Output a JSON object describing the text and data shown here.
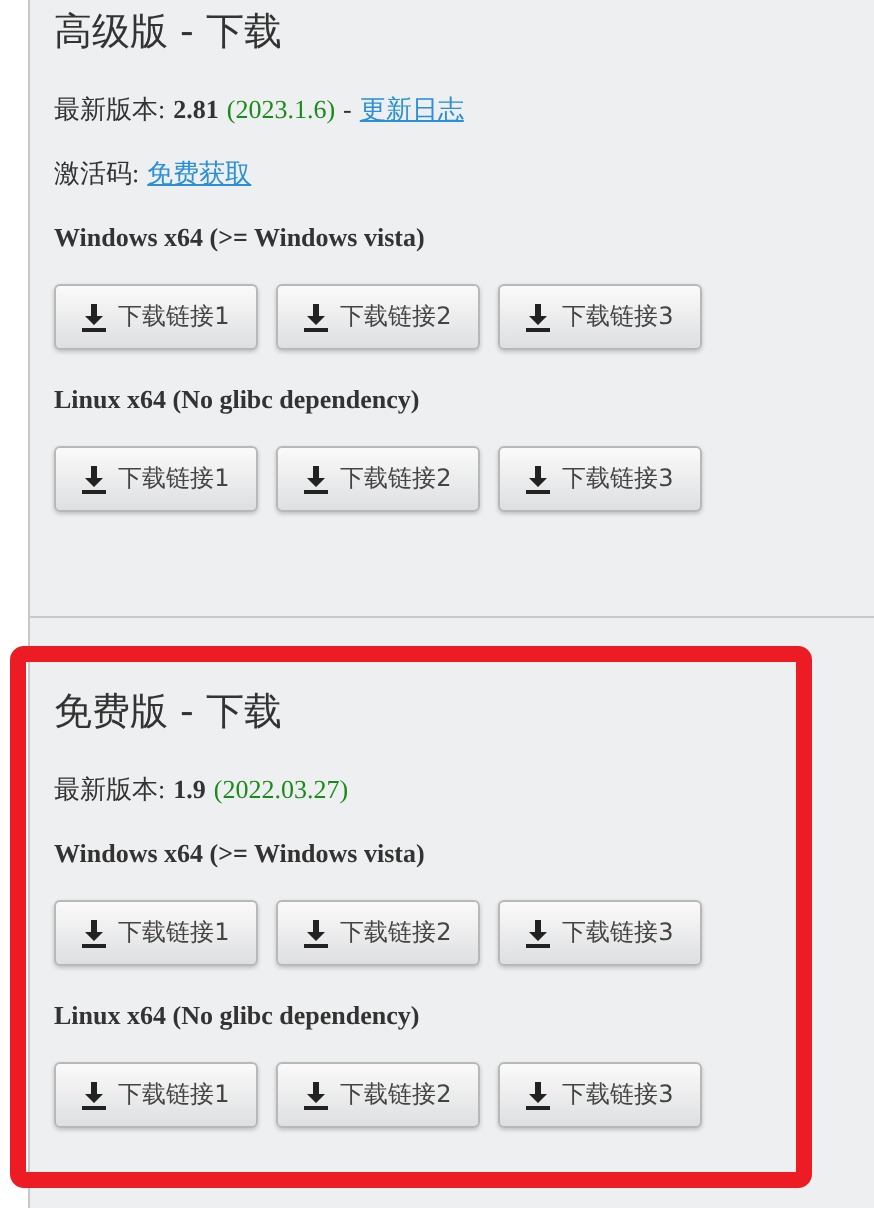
{
  "sections": [
    {
      "title": "高级版 - 下载",
      "highlighted": false,
      "version_label": "最新版本:",
      "version": "2.81",
      "date": "(2023.1.6)",
      "separator": "-",
      "changelog_link": "更新日志",
      "activation_label": "激活码:",
      "activation_link": "免费获取",
      "groups": [
        {
          "heading": "Windows x64 (>= Windows vista)",
          "buttons": [
            "下载链接1",
            "下载链接2",
            "下载链接3"
          ]
        },
        {
          "heading": "Linux x64 (No glibc dependency)",
          "buttons": [
            "下载链接1",
            "下载链接2",
            "下载链接3"
          ]
        }
      ]
    },
    {
      "title": "免费版 - 下载",
      "highlighted": true,
      "version_label": "最新版本:",
      "version": "1.9",
      "date": "(2022.03.27)",
      "groups": [
        {
          "heading": "Windows x64 (>= Windows vista)",
          "buttons": [
            "下载链接1",
            "下载链接2",
            "下载链接3"
          ]
        },
        {
          "heading": "Linux x64 (No glibc dependency)",
          "buttons": [
            "下载链接1",
            "下载链接2",
            "下载链接3"
          ]
        }
      ]
    }
  ]
}
